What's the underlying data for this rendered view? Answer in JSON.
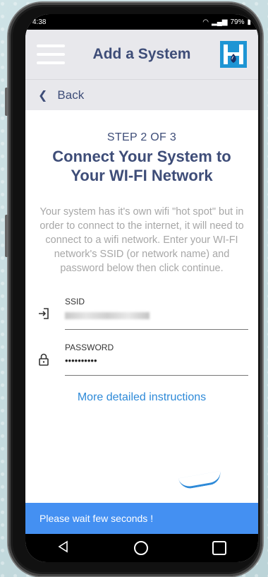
{
  "status_bar": {
    "time": "4:38",
    "battery": "79%"
  },
  "header": {
    "title": "Add a System"
  },
  "back": {
    "label": "Back"
  },
  "content": {
    "step": "STEP 2 OF 3",
    "title_line1": "Connect Your System to",
    "title_line2": "Your WI-FI Network",
    "description": "Your system has it's own wifi \"hot spot\" but in order to connect to the internet, it will need to connect to a wifi network. Enter your WI-FI network's SSID (or network name) and password below then click continue."
  },
  "form": {
    "ssid_label": "SSID",
    "password_label": "PASSWORD",
    "password_value": "••••••••••"
  },
  "links": {
    "more_instructions": "More detailed instructions"
  },
  "toast": {
    "message": "Please wait few seconds !"
  },
  "colors": {
    "accent": "#3e4d78",
    "link": "#2e8ad8",
    "toast": "#4490f2",
    "logo": "#1e95d4"
  }
}
